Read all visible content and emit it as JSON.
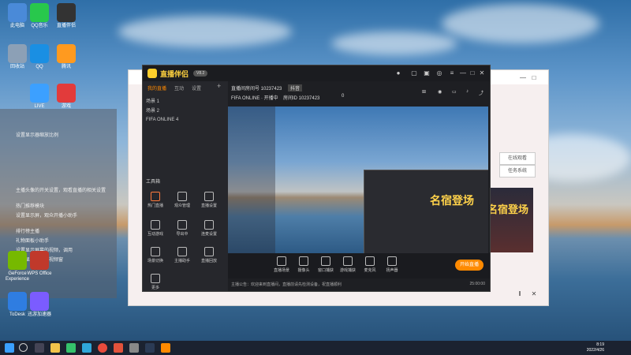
{
  "desktop": {
    "icons": [
      {
        "label": "此电脑",
        "color": "#4a8ad8"
      },
      {
        "label": "QQ音乐",
        "color": "#28c84c"
      },
      {
        "label": "直播伴侣",
        "color": "#333"
      },
      {
        "label": "回收站",
        "color": "#8ca0b6"
      },
      {
        "label": "QQ",
        "color": "#1a8fe3"
      },
      {
        "label": "腾讯",
        "color": "#ff9a1f"
      },
      {
        "label": "LIVE",
        "color": "#3ca0ff"
      },
      {
        "label": "游戏",
        "color": "#e23b3b"
      }
    ],
    "bottom_icons": [
      {
        "label": "GeForce Experience",
        "color": "#76b900"
      },
      {
        "label": "WPS Office",
        "color": "#c0392b"
      },
      {
        "label": "ToDesk",
        "color": "#2f7de1"
      },
      {
        "label": "迅游加速器",
        "color": "#7b5cff"
      }
    ]
  },
  "side_panel": {
    "lines": [
      "设置显示器缩放比例",
      "主播头像的开关设置，观看直播的相关设置",
      "热门推荐模块",
      "设置显示屏，观众开播小助手",
      "排行榜主播",
      "礼物面板小助手",
      "设置显示屏幕的视频，调用",
      "双屏显示设置小视频窗"
    ]
  },
  "back_window": {
    "buttons": [
      "在线观看",
      "任务系统"
    ],
    "banner_text": "名宿登场"
  },
  "app": {
    "title": "直播伴侣",
    "version": "V8.2",
    "left_tabs": [
      "我的直播",
      "互动",
      "设置"
    ],
    "scenes": [
      "场景 1",
      "场景 2",
      "FIFA ONLINE 4"
    ],
    "tools_label": "工具箱",
    "tools": [
      "热门直播",
      "观众管理",
      "直播设置",
      "互动游戏",
      "导出中",
      "连麦设置",
      "场景切换",
      "主播助手",
      "直播回放",
      "更多"
    ],
    "room_label": "直播间房间号 10237423",
    "room_tag": "抖音",
    "game_tag": "FIFA ONLINE · 开播中",
    "room_info": "房间ID 10237423",
    "viewers": "0",
    "bottom_tools": [
      "直播场景",
      "摄像头",
      "窗口捕获",
      "游戏捕获",
      "麦克风",
      "扬声器"
    ],
    "start_button": "开始直播",
    "status_left": "主播公告：欢迎来到直播间，直播前请先检测设备，祝直播顺利",
    "status_right": "25:00:00",
    "preview_text": "名宿登场"
  },
  "taskbar": {
    "time": "8:19",
    "date": "2022/4/26",
    "icons": [
      "start",
      "search",
      "task-view",
      "files",
      "wechat",
      "edge",
      "chrome",
      "game",
      "settings",
      "steam",
      "live"
    ]
  }
}
